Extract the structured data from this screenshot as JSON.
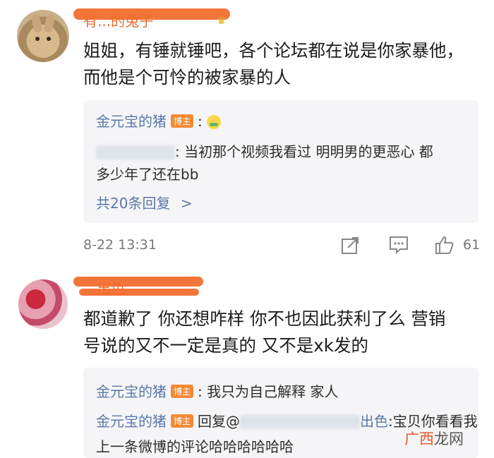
{
  "comments": [
    {
      "username": "有...的兔子",
      "text_line1": "姐姐，有锤就锤吧，各个论坛都在说是你家暴他，",
      "text_line2": "而他是个可怜的被家暴的人",
      "replies": [
        {
          "author": "金元宝的猪",
          "badge": "博主",
          "separator": ":",
          "reply_to_text_line1": ": 当初那个视频我看过  明明男的更恶心  都",
          "reply_to_text_line2": "多少年了还在bb"
        }
      ],
      "more_replies": "共20条回复",
      "more_chevron": ">",
      "timestamp": "8-22 13:31",
      "like_count": "61"
    },
    {
      "username": "...出色",
      "text_line1": "都道歉了  你还想咋样  你不也因此获利了么  营销",
      "text_line2": "号说的又不一定是真的  又不是xk发的",
      "replies": [
        {
          "author": "金元宝的猪",
          "badge": "博主",
          "text": ": 我只为自己解释  家人"
        },
        {
          "author": "金元宝的猪",
          "badge": "博主",
          "reply_prefix": "回复@",
          "mention_suffix": "出色",
          "text_line1": ":宝贝你看看我",
          "text_line2": "上一条微博的评论哈哈哈哈哈哈"
        }
      ]
    }
  ],
  "watermark": {
    "brand": "广西",
    "brand2": "龙网"
  },
  "colors": {
    "username": "#e36c2d",
    "reply_name": "#5a78a8",
    "badge": "#f28a35",
    "meta": "#777777"
  }
}
